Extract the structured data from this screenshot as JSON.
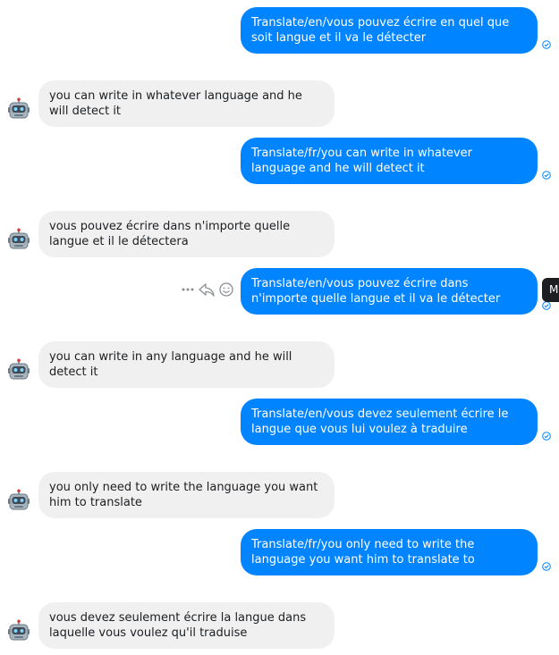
{
  "conversation": {
    "messages": [
      {
        "direction": "outgoing",
        "text": "Translate/en/vous pouvez écrire en quel que soit langue et il va le détecter"
      },
      {
        "direction": "incoming",
        "text": "you can write in whatever language and he will detect it"
      },
      {
        "direction": "outgoing",
        "text": "Translate/fr/you can write in whatever language and he will detect it"
      },
      {
        "direction": "incoming",
        "text": "vous pouvez écrire dans n'importe quelle langue et il le détectera"
      },
      {
        "direction": "outgoing",
        "text": "Translate/en/vous pouvez écrire dans n'importe quelle langue et il va le détecter"
      },
      {
        "direction": "incoming",
        "text": "you can write in any language and he will detect it"
      },
      {
        "direction": "outgoing",
        "text": "Translate/en/vous devez seulement écrire le langue que vous lui voulez à traduire"
      },
      {
        "direction": "incoming",
        "text": "you only need to write the language you want him to translate"
      },
      {
        "direction": "outgoing",
        "text": "Translate/fr/you only need to write the language you want him to translate to"
      },
      {
        "direction": "incoming",
        "text": "vous devez seulement écrire la langue dans laquelle vous voulez qu'il traduise"
      }
    ]
  },
  "hover_actions": {
    "icons": [
      "more-icon",
      "reply-icon",
      "react-icon"
    ]
  },
  "tooltip": {
    "text": "M"
  },
  "colors": {
    "outgoing_bubble": "#0084ff",
    "incoming_bubble": "#f0f0f0",
    "read_receipt": "#0084ff",
    "tooltip_bg": "#1c1e21"
  },
  "icons": {
    "avatar": "robot-icon",
    "receipt": "check-circle-icon"
  }
}
